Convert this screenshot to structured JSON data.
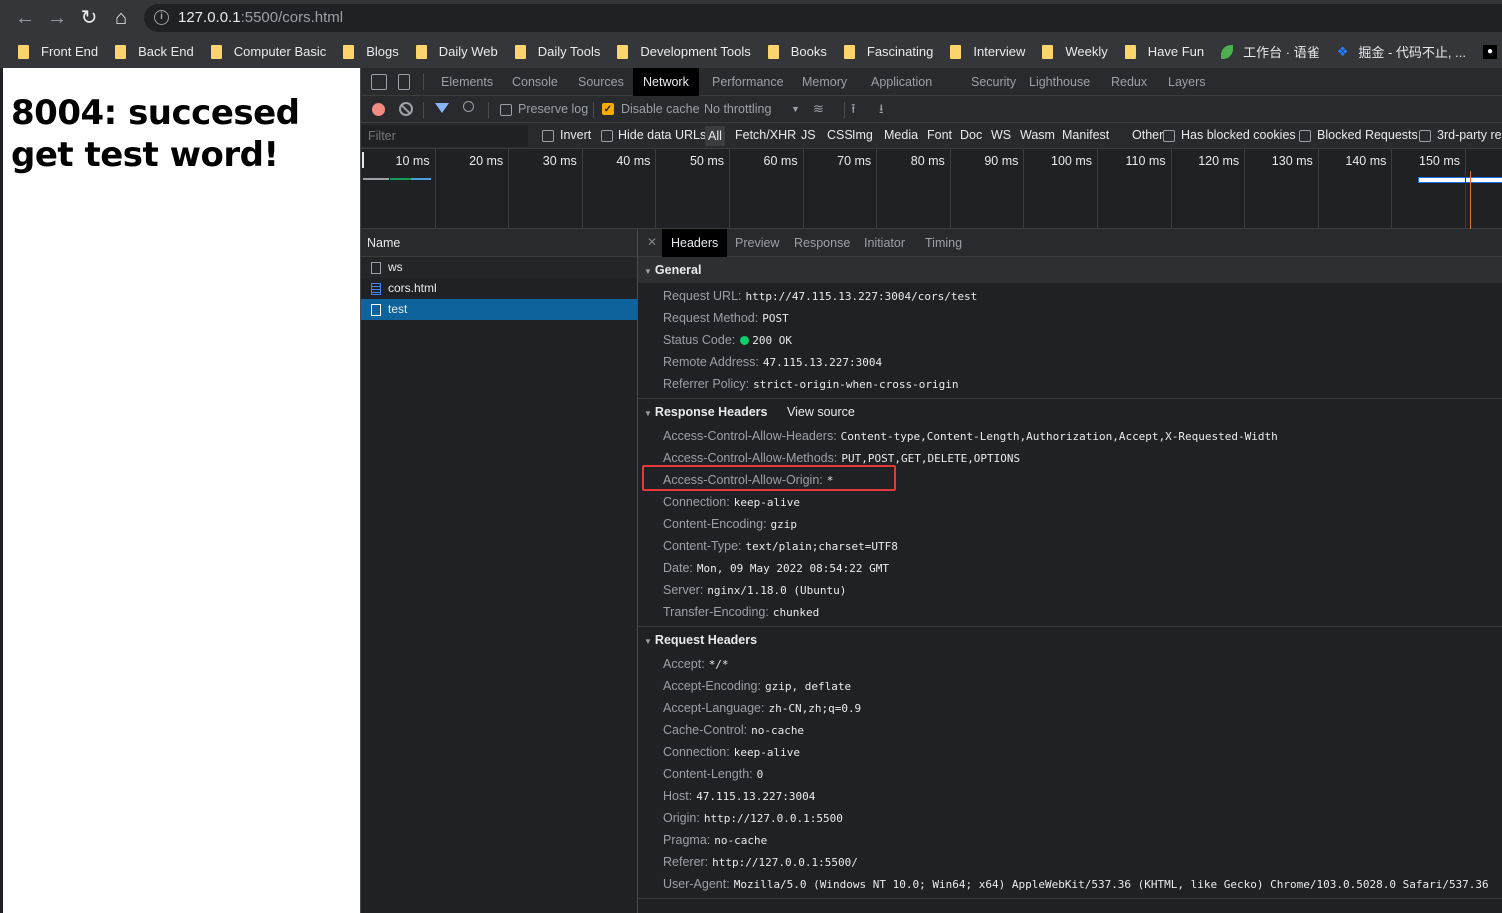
{
  "browser": {
    "url_host": "127.0.0.1",
    "url_rest": ":5500/cors.html",
    "bookmarks": [
      {
        "label": "Front End",
        "icon": "folder"
      },
      {
        "label": "Back End",
        "icon": "folder"
      },
      {
        "label": "Computer Basic",
        "icon": "folder"
      },
      {
        "label": "Blogs",
        "icon": "folder"
      },
      {
        "label": "Daily Web",
        "icon": "folder"
      },
      {
        "label": "Daily Tools",
        "icon": "folder"
      },
      {
        "label": "Development Tools",
        "icon": "folder"
      },
      {
        "label": "Books",
        "icon": "folder"
      },
      {
        "label": "Fascinating",
        "icon": "folder"
      },
      {
        "label": "Interview",
        "icon": "folder"
      },
      {
        "label": "Weekly",
        "icon": "folder"
      },
      {
        "label": "Have Fun",
        "icon": "folder"
      },
      {
        "label": "工作台 · 语雀",
        "icon": "yuque-leaf"
      },
      {
        "label": "掘金 - 代码不止, ...",
        "icon": "juejin"
      },
      {
        "label": "M",
        "icon": "m-logo"
      }
    ]
  },
  "page": {
    "heading": "8004: succesed get test word!"
  },
  "devtools": {
    "tabs": [
      "Elements",
      "Console",
      "Sources",
      "Network",
      "Performance",
      "Memory",
      "Application",
      "Security",
      "Lighthouse",
      "Redux",
      "Layers"
    ],
    "active_tab": "Network",
    "toolbar": {
      "preserve_log": "Preserve log",
      "preserve_log_checked": false,
      "disable_cache": "Disable cache",
      "disable_cache_checked": true,
      "throttling": "No throttling"
    },
    "filter": {
      "placeholder": "Filter",
      "invert": "Invert",
      "hide_data_urls": "Hide data URLs",
      "types": [
        "All",
        "Fetch/XHR",
        "JS",
        "CSS",
        "Img",
        "Media",
        "Font",
        "Doc",
        "WS",
        "Wasm",
        "Manifest",
        "Other"
      ],
      "active_type": "All",
      "has_blocked_cookies": "Has blocked cookies",
      "blocked_requests": "Blocked Requests",
      "third_party": "3rd-party re"
    },
    "timeline_ticks": [
      "10 ms",
      "20 ms",
      "30 ms",
      "40 ms",
      "50 ms",
      "60 ms",
      "70 ms",
      "80 ms",
      "90 ms",
      "100 ms",
      "110 ms",
      "120 ms",
      "130 ms",
      "140 ms",
      "150 ms"
    ],
    "request_list": {
      "header": "Name",
      "rows": [
        {
          "name": "ws",
          "type": "other",
          "selected": false
        },
        {
          "name": "cors.html",
          "type": "html",
          "selected": false
        },
        {
          "name": "test",
          "type": "other",
          "selected": true
        }
      ]
    },
    "details": {
      "tabs": [
        "Headers",
        "Preview",
        "Response",
        "Initiator",
        "Timing"
      ],
      "active_tab": "Headers",
      "general": {
        "title": "General",
        "rows": [
          {
            "name": "Request URL:",
            "value": "http://47.115.13.227:3004/cors/test"
          },
          {
            "name": "Request Method:",
            "value": "POST"
          },
          {
            "name": "Status Code:",
            "value": "200 OK",
            "status_color": "#0cce6b"
          },
          {
            "name": "Remote Address:",
            "value": "47.115.13.227:3004"
          },
          {
            "name": "Referrer Policy:",
            "value": "strict-origin-when-cross-origin"
          }
        ]
      },
      "response_headers": {
        "title": "Response Headers",
        "view_source": "View source",
        "rows": [
          {
            "name": "Access-Control-Allow-Headers:",
            "value": "Content-type,Content-Length,Authorization,Accept,X-Requested-Width"
          },
          {
            "name": "Access-Control-Allow-Methods:",
            "value": "PUT,POST,GET,DELETE,OPTIONS"
          },
          {
            "name": "Access-Control-Allow-Origin:",
            "value": "*",
            "highlighted": true
          },
          {
            "name": "Connection:",
            "value": "keep-alive"
          },
          {
            "name": "Content-Encoding:",
            "value": "gzip"
          },
          {
            "name": "Content-Type:",
            "value": "text/plain;charset=UTF8"
          },
          {
            "name": "Date:",
            "value": "Mon, 09 May 2022 08:54:22 GMT"
          },
          {
            "name": "Server:",
            "value": "nginx/1.18.0 (Ubuntu)"
          },
          {
            "name": "Transfer-Encoding:",
            "value": "chunked"
          }
        ]
      },
      "request_headers": {
        "title": "Request Headers",
        "rows": [
          {
            "name": "Accept:",
            "value": "*/*"
          },
          {
            "name": "Accept-Encoding:",
            "value": "gzip, deflate"
          },
          {
            "name": "Accept-Language:",
            "value": "zh-CN,zh;q=0.9"
          },
          {
            "name": "Cache-Control:",
            "value": "no-cache"
          },
          {
            "name": "Connection:",
            "value": "keep-alive"
          },
          {
            "name": "Content-Length:",
            "value": "0"
          },
          {
            "name": "Host:",
            "value": "47.115.13.227:3004"
          },
          {
            "name": "Origin:",
            "value": "http://127.0.0.1:5500"
          },
          {
            "name": "Pragma:",
            "value": "no-cache"
          },
          {
            "name": "Referer:",
            "value": "http://127.0.0.1:5500/"
          },
          {
            "name": "User-Agent:",
            "value": "Mozilla/5.0 (Windows NT 10.0; Win64; x64) AppleWebKit/537.36 (KHTML, like Gecko) Chrome/103.0.5028.0 Safari/537.36"
          }
        ]
      }
    }
  }
}
